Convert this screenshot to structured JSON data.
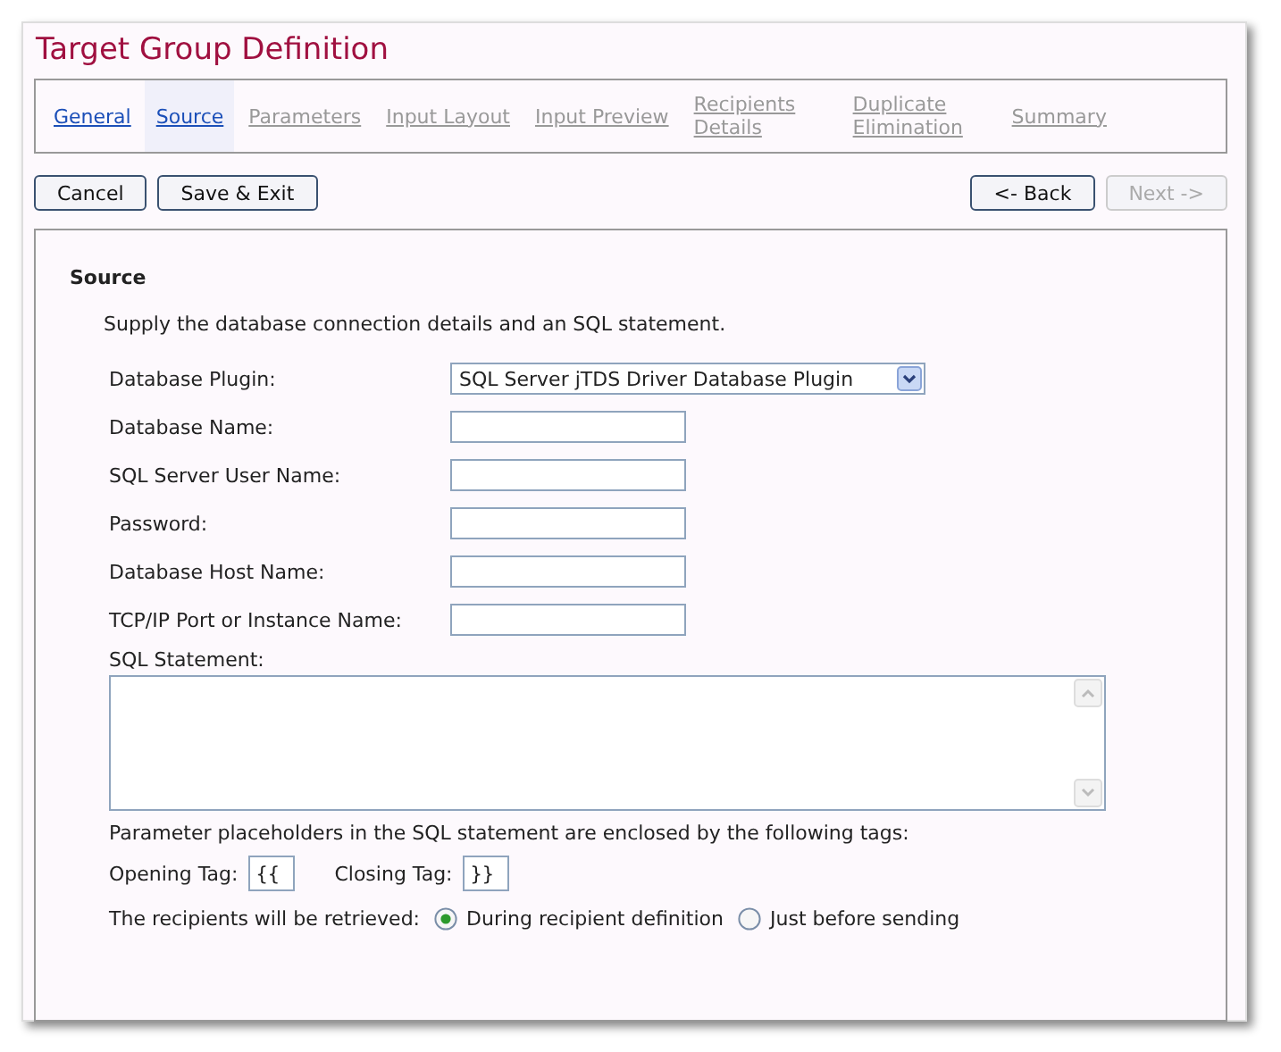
{
  "window": {
    "title": "Target Group Definition"
  },
  "tabs": [
    {
      "label": "General",
      "selected": false,
      "disabled": false
    },
    {
      "label": "Source",
      "selected": true,
      "disabled": false
    },
    {
      "label": "Parameters",
      "selected": false,
      "disabled": true
    },
    {
      "label": "Input Layout",
      "selected": false,
      "disabled": true
    },
    {
      "label": "Input Preview",
      "selected": false,
      "disabled": true
    },
    {
      "label": "Recipients Details",
      "selected": false,
      "disabled": true
    },
    {
      "label": "Duplicate Elimination",
      "selected": false,
      "disabled": true
    },
    {
      "label": "Summary",
      "selected": false,
      "disabled": true
    }
  ],
  "left_buttons": [
    {
      "label": "Cancel",
      "disabled": false
    },
    {
      "label": "Save & Exit",
      "disabled": false
    }
  ],
  "right_buttons": [
    {
      "label": "<- Back",
      "disabled": false
    },
    {
      "label": "Next ->",
      "disabled": true
    }
  ],
  "section": {
    "heading": "Source",
    "intro": "Supply the database connection details and an SQL statement.",
    "fields": [
      {
        "kind": "select",
        "label": "Database Plugin:",
        "value": "SQL Server jTDS Driver Database Plugin"
      },
      {
        "kind": "text",
        "label": "Database Name:"
      },
      {
        "kind": "text",
        "label": "SQL Server User Name:"
      },
      {
        "kind": "text",
        "label": "Password:"
      },
      {
        "kind": "text",
        "label": "Database Host Name:"
      },
      {
        "kind": "text",
        "label": "TCP/IP Port or Instance Name:"
      }
    ],
    "sql_label": "SQL Statement:",
    "tags_note": "Parameter placeholders in the SQL statement are enclosed by the following tags:",
    "opening_tag": {
      "label": "Opening Tag:",
      "value": "{{"
    },
    "closing_tag": {
      "label": "Closing Tag:",
      "value": "}}"
    },
    "retrieval": {
      "label": "The recipients will be retrieved:",
      "options": [
        {
          "label": "During recipient definition",
          "selected": true
        },
        {
          "label": "Just before sending",
          "selected": false
        }
      ]
    }
  }
}
